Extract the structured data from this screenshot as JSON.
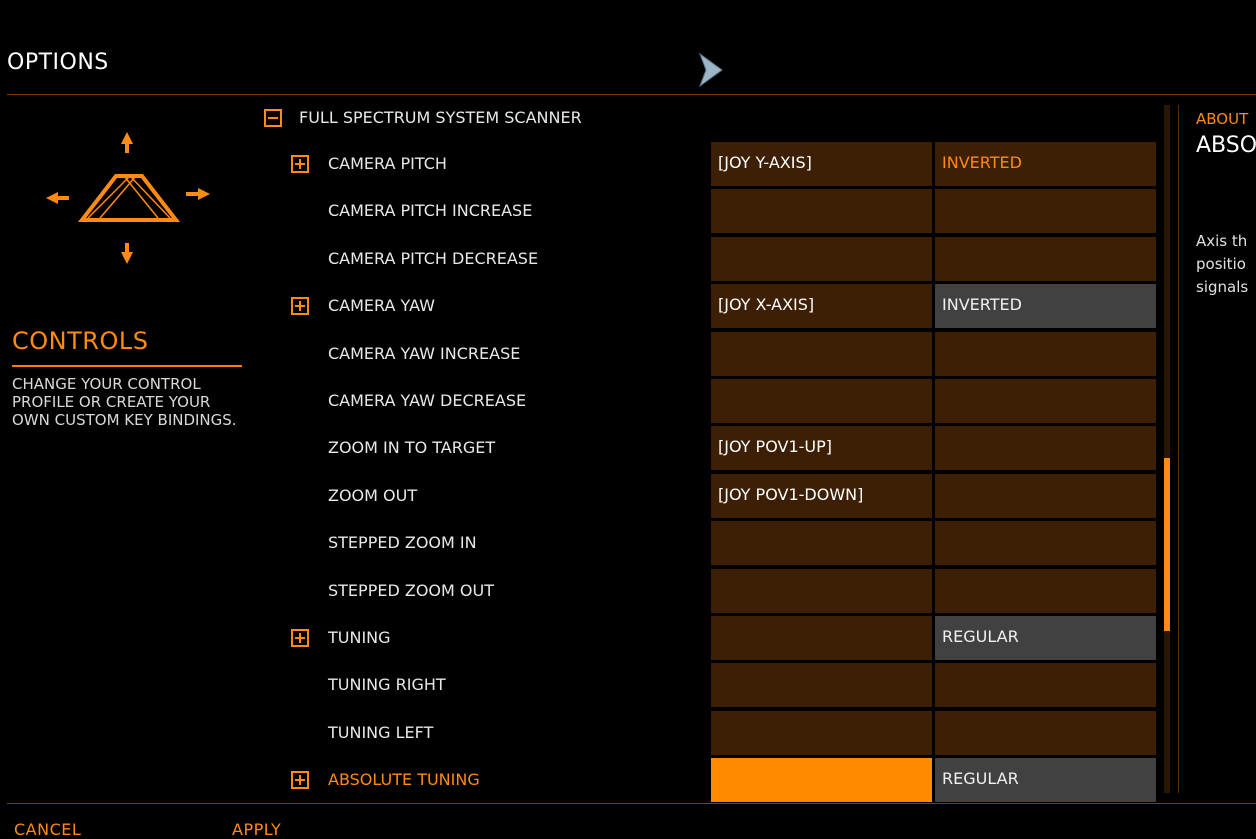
{
  "header": {
    "title": "OPTIONS"
  },
  "left_panel": {
    "heading": "CONTROLS",
    "description": "CHANGE YOUR CONTROL PROFILE OR CREATE YOUR OWN CUSTOM KEY BINDINGS."
  },
  "section": {
    "label": "FULL SPECTRUM SYSTEM SCANNER",
    "expanded": true
  },
  "rows": [
    {
      "label": "CAMERA PITCH",
      "expandable": true,
      "binding": "[JOY Y-AXIS]",
      "option": "INVERTED",
      "option_style": "orange"
    },
    {
      "label": "CAMERA PITCH INCREASE",
      "expandable": false,
      "binding": "",
      "option": "",
      "option_style": "orange"
    },
    {
      "label": "CAMERA PITCH DECREASE",
      "expandable": false,
      "binding": "",
      "option": "",
      "option_style": "orange"
    },
    {
      "label": "CAMERA YAW",
      "expandable": true,
      "binding": "[JOY X-AXIS]",
      "option": "INVERTED",
      "option_style": "grey"
    },
    {
      "label": "CAMERA YAW INCREASE",
      "expandable": false,
      "binding": "",
      "option": "",
      "option_style": "orange"
    },
    {
      "label": "CAMERA YAW DECREASE",
      "expandable": false,
      "binding": "",
      "option": "",
      "option_style": "orange"
    },
    {
      "label": "ZOOM IN TO TARGET",
      "expandable": false,
      "binding": "[JOY POV1-UP]",
      "option": "",
      "option_style": "orange"
    },
    {
      "label": "ZOOM OUT",
      "expandable": false,
      "binding": "[JOY POV1-DOWN]",
      "option": "",
      "option_style": "orange"
    },
    {
      "label": "STEPPED ZOOM IN",
      "expandable": false,
      "binding": "",
      "option": "",
      "option_style": "orange"
    },
    {
      "label": "STEPPED ZOOM OUT",
      "expandable": false,
      "binding": "",
      "option": "",
      "option_style": "orange"
    },
    {
      "label": "TUNING",
      "expandable": true,
      "binding": "",
      "option": "REGULAR",
      "option_style": "grey"
    },
    {
      "label": "TUNING RIGHT",
      "expandable": false,
      "binding": "",
      "option": "",
      "option_style": "orange"
    },
    {
      "label": "TUNING LEFT",
      "expandable": false,
      "binding": "",
      "option": "",
      "option_style": "orange"
    },
    {
      "label": "ABSOLUTE TUNING",
      "expandable": true,
      "binding": "",
      "option": "REGULAR",
      "option_style": "grey",
      "highlighted": true
    }
  ],
  "info_panel": {
    "label": "ABOUT",
    "title": "ABSO",
    "text": "Axis th\npositio\nsignals"
  },
  "footer": {
    "cancel": "CANCEL",
    "apply": "APPLY"
  },
  "colors": {
    "accent": "#ff8a14",
    "cell_bg": "#3d1f05",
    "grey_cell": "#414141"
  }
}
